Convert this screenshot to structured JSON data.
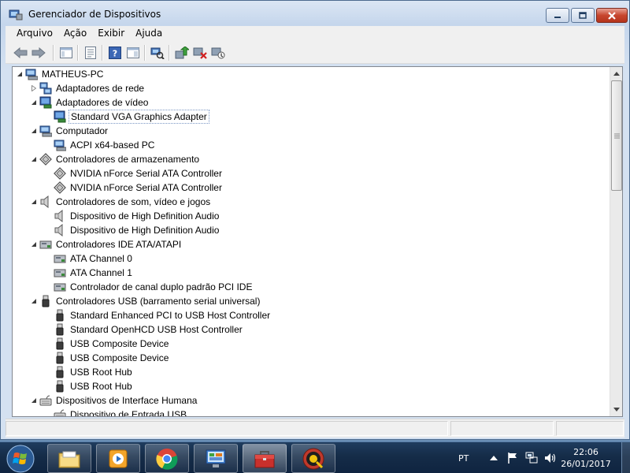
{
  "window": {
    "title": "Gerenciador de Dispositivos"
  },
  "menu": {
    "items": [
      "Arquivo",
      "Ação",
      "Exibir",
      "Ajuda"
    ]
  },
  "toolbar": {
    "buttons": [
      "back-icon",
      "forward-icon",
      "show-hide-console-tree-icon",
      "properties-icon",
      "help-icon",
      "view-icon",
      "scan-hardware-icon",
      "update-driver-icon",
      "disable-device-icon",
      "uninstall-device-icon"
    ]
  },
  "tree": {
    "root": "MATHEUS-PC",
    "nodes": [
      {
        "label": "Adaptadores de rede",
        "level": 1,
        "expander": "collapsed",
        "icon": "network-adapter-icon"
      },
      {
        "label": "Adaptadores de vídeo",
        "level": 1,
        "expander": "expanded",
        "icon": "display-adapter-icon"
      },
      {
        "label": "Standard VGA Graphics Adapter",
        "level": 2,
        "expander": "none",
        "icon": "display-adapter-icon",
        "selected": true
      },
      {
        "label": "Computador",
        "level": 1,
        "expander": "expanded",
        "icon": "computer-icon"
      },
      {
        "label": "ACPI x64-based PC",
        "level": 2,
        "expander": "none",
        "icon": "computer-icon"
      },
      {
        "label": "Controladores de armazenamento",
        "level": 1,
        "expander": "expanded",
        "icon": "storage-controller-icon"
      },
      {
        "label": "NVIDIA nForce Serial ATA Controller",
        "level": 2,
        "expander": "none",
        "icon": "storage-controller-icon"
      },
      {
        "label": "NVIDIA nForce Serial ATA Controller",
        "level": 2,
        "expander": "none",
        "icon": "storage-controller-icon"
      },
      {
        "label": "Controladores de som, vídeo e jogos",
        "level": 1,
        "expander": "expanded",
        "icon": "speaker-icon"
      },
      {
        "label": "Dispositivo de High Definition Audio",
        "level": 2,
        "expander": "none",
        "icon": "speaker-icon"
      },
      {
        "label": "Dispositivo de High Definition Audio",
        "level": 2,
        "expander": "none",
        "icon": "speaker-icon"
      },
      {
        "label": "Controladores IDE ATA/ATAPI",
        "level": 1,
        "expander": "expanded",
        "icon": "ide-controller-icon"
      },
      {
        "label": "ATA Channel 0",
        "level": 2,
        "expander": "none",
        "icon": "ide-controller-icon"
      },
      {
        "label": "ATA Channel 1",
        "level": 2,
        "expander": "none",
        "icon": "ide-controller-icon"
      },
      {
        "label": "Controlador de canal duplo padrão PCI IDE",
        "level": 2,
        "expander": "none",
        "icon": "ide-controller-icon"
      },
      {
        "label": "Controladores USB (barramento serial universal)",
        "level": 1,
        "expander": "expanded",
        "icon": "usb-icon"
      },
      {
        "label": "Standard Enhanced PCI to USB Host Controller",
        "level": 2,
        "expander": "none",
        "icon": "usb-icon"
      },
      {
        "label": "Standard OpenHCD USB Host Controller",
        "level": 2,
        "expander": "none",
        "icon": "usb-icon"
      },
      {
        "label": "USB Composite Device",
        "level": 2,
        "expander": "none",
        "icon": "usb-icon"
      },
      {
        "label": "USB Composite Device",
        "level": 2,
        "expander": "none",
        "icon": "usb-icon"
      },
      {
        "label": "USB Root Hub",
        "level": 2,
        "expander": "none",
        "icon": "usb-icon"
      },
      {
        "label": "USB Root Hub",
        "level": 2,
        "expander": "none",
        "icon": "usb-icon"
      },
      {
        "label": "Dispositivos de Interface Humana",
        "level": 1,
        "expander": "expanded",
        "icon": "hid-icon"
      },
      {
        "label": "Dispositivo de Entrada USB",
        "level": 2,
        "expander": "none",
        "icon": "hid-icon"
      }
    ]
  },
  "taskbar": {
    "items": [
      "explorer-icon",
      "media-player-icon",
      "chrome-icon",
      "control-panel-icon",
      "device-manager-toolbox-icon",
      "app-icon"
    ],
    "active_index": 4,
    "language": "PT",
    "tray_icons": [
      "show-hidden-icons-icon",
      "action-center-flag-icon",
      "network-icon",
      "volume-icon"
    ],
    "time": "22:06",
    "date": "26/01/2017"
  },
  "colors": {
    "accent": "#3c6aa5",
    "selection_border": "#7a96c4",
    "close_red": "#c7462e"
  }
}
